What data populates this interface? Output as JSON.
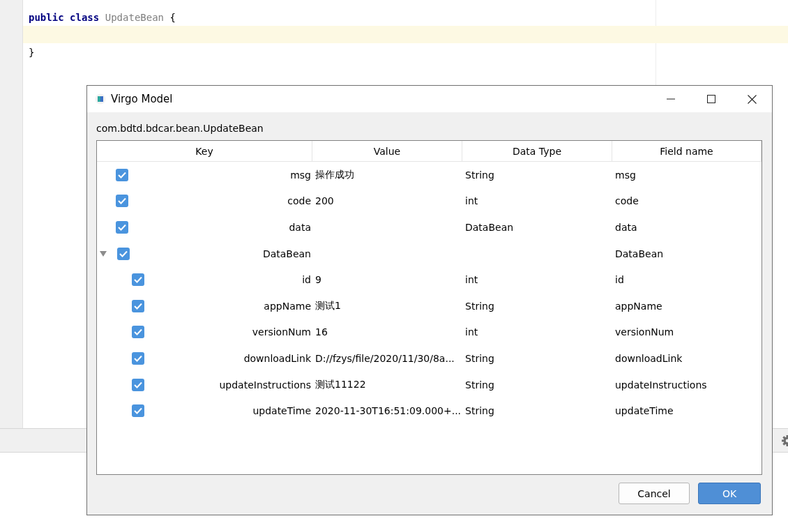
{
  "editor": {
    "lines": [
      {
        "current": false,
        "tokens": [
          {
            "text": "public",
            "kind": "keyword"
          },
          {
            "text": "class",
            "kind": "keyword"
          },
          {
            "text": "UpdateBean",
            "kind": "unused"
          },
          {
            "text": "{",
            "kind": "brace"
          }
        ]
      },
      {
        "current": true
      },
      {
        "current": false,
        "tokens": [
          {
            "text": "}",
            "kind": "brace"
          }
        ]
      }
    ]
  },
  "dialog": {
    "title": "Virgo Model",
    "class_name": "com.bdtd.bdcar.bean.UpdateBean",
    "table": {
      "columns": [
        "Key",
        "Value",
        "Data Type",
        "Field name"
      ],
      "rows": [
        {
          "checked": true,
          "key": "msg",
          "value": "操作成功",
          "type": "String",
          "field": "msg"
        },
        {
          "checked": true,
          "key": "code",
          "value": "200",
          "type": "int",
          "field": "code"
        },
        {
          "checked": true,
          "key": "data",
          "type": "DataBean",
          "field": "data"
        },
        {
          "checked": true,
          "key": "DataBean",
          "field": "DataBean",
          "expanded": true,
          "children": [
            {
              "checked": true,
              "key": "id",
              "value": "9",
              "type": "int",
              "field": "id"
            },
            {
              "checked": true,
              "key": "appName",
              "value": "测试1",
              "type": "String",
              "field": "appName"
            },
            {
              "checked": true,
              "key": "versionNum",
              "value": "16",
              "type": "int",
              "field": "versionNum"
            },
            {
              "checked": true,
              "key": "downloadLink",
              "value": "D://fzys/file/2020/11/30/8a...",
              "type": "String",
              "field": "downloadLink"
            },
            {
              "checked": true,
              "key": "updateInstructions",
              "value": "测试11122",
              "type": "String",
              "field": "updateInstructions"
            },
            {
              "checked": true,
              "key": "updateTime",
              "value": "2020-11-30T16:51:09.000+...",
              "type": "String",
              "field": "updateTime"
            }
          ]
        }
      ]
    },
    "buttons": [
      {
        "label": "Cancel",
        "kind": "secondary"
      },
      {
        "label": "OK",
        "kind": "primary"
      }
    ]
  }
}
